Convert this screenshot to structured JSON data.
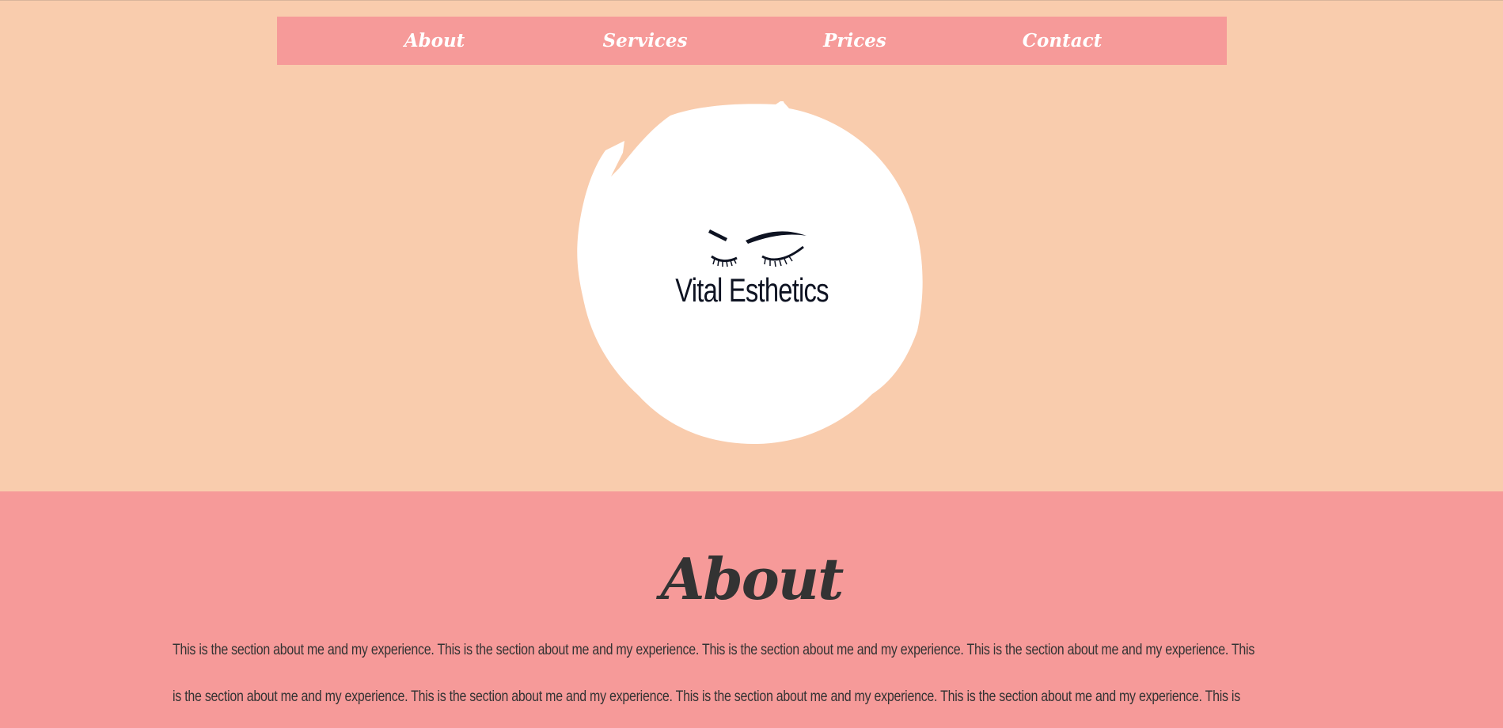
{
  "nav": {
    "items": [
      {
        "label": "About"
      },
      {
        "label": "Services"
      },
      {
        "label": "Prices"
      },
      {
        "label": "Contact"
      }
    ]
  },
  "hero": {
    "brand_name": "Vital Esthetics"
  },
  "about": {
    "title": "About",
    "text_lines": [
      "This is the section about me and my experience. This is the section about me and my experience. This is the section about me and my experience. This is the section about me and my experience. This",
      "is the section about me and my experience. This is the section about me and my experience. This is the section about me and my experience. This is the section about me and my experience. This is"
    ]
  },
  "colors": {
    "page_background": "#f9ccad",
    "nav_background": "#f69a99",
    "about_background": "#f69a99",
    "text_dark": "#333333",
    "logo_ink": "#0e1322"
  }
}
